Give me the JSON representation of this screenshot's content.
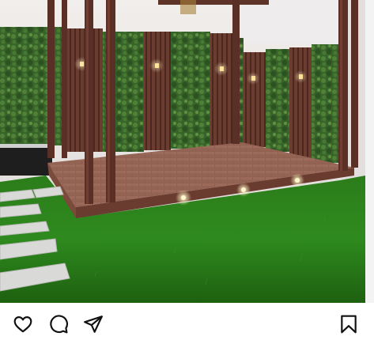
{
  "post": {
    "image_description_alt": "",
    "colors": {
      "wall": "#e7e4e3",
      "wood": "#6e3e31",
      "wood_dark": "#552c22",
      "deck": "#8c5a4b",
      "grass": "#2f8a1e",
      "grass_dark": "#1f6712",
      "greenery": "#3a6a2c",
      "stone": "#d7d8d5",
      "light": "#fff3b0"
    }
  },
  "actions": {
    "like_icon": "heart-icon",
    "comment_icon": "speech-bubble-icon",
    "share_icon": "paper-plane-icon",
    "save_icon": "bookmark-icon",
    "icon_color": "#111111"
  }
}
